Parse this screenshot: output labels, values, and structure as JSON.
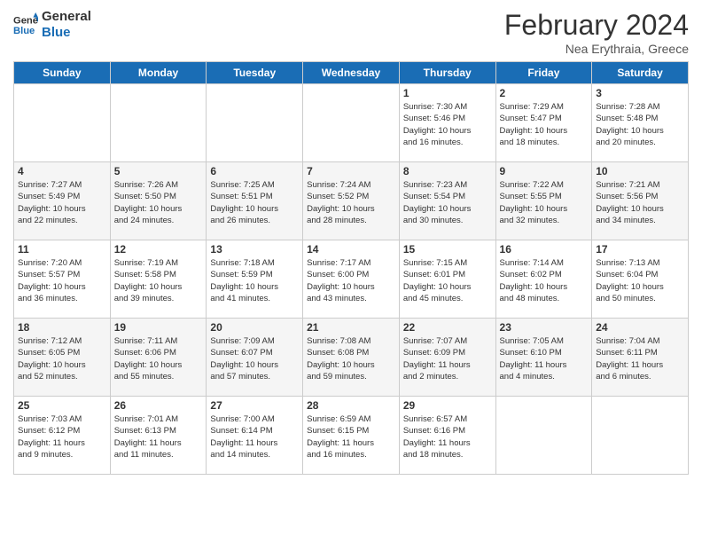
{
  "logo": {
    "line1": "General",
    "line2": "Blue"
  },
  "header": {
    "title": "February 2024",
    "subtitle": "Nea Erythraia, Greece"
  },
  "weekdays": [
    "Sunday",
    "Monday",
    "Tuesday",
    "Wednesday",
    "Thursday",
    "Friday",
    "Saturday"
  ],
  "weeks": [
    [
      {
        "day": "",
        "info": ""
      },
      {
        "day": "",
        "info": ""
      },
      {
        "day": "",
        "info": ""
      },
      {
        "day": "",
        "info": ""
      },
      {
        "day": "1",
        "info": "Sunrise: 7:30 AM\nSunset: 5:46 PM\nDaylight: 10 hours\nand 16 minutes."
      },
      {
        "day": "2",
        "info": "Sunrise: 7:29 AM\nSunset: 5:47 PM\nDaylight: 10 hours\nand 18 minutes."
      },
      {
        "day": "3",
        "info": "Sunrise: 7:28 AM\nSunset: 5:48 PM\nDaylight: 10 hours\nand 20 minutes."
      }
    ],
    [
      {
        "day": "4",
        "info": "Sunrise: 7:27 AM\nSunset: 5:49 PM\nDaylight: 10 hours\nand 22 minutes."
      },
      {
        "day": "5",
        "info": "Sunrise: 7:26 AM\nSunset: 5:50 PM\nDaylight: 10 hours\nand 24 minutes."
      },
      {
        "day": "6",
        "info": "Sunrise: 7:25 AM\nSunset: 5:51 PM\nDaylight: 10 hours\nand 26 minutes."
      },
      {
        "day": "7",
        "info": "Sunrise: 7:24 AM\nSunset: 5:52 PM\nDaylight: 10 hours\nand 28 minutes."
      },
      {
        "day": "8",
        "info": "Sunrise: 7:23 AM\nSunset: 5:54 PM\nDaylight: 10 hours\nand 30 minutes."
      },
      {
        "day": "9",
        "info": "Sunrise: 7:22 AM\nSunset: 5:55 PM\nDaylight: 10 hours\nand 32 minutes."
      },
      {
        "day": "10",
        "info": "Sunrise: 7:21 AM\nSunset: 5:56 PM\nDaylight: 10 hours\nand 34 minutes."
      }
    ],
    [
      {
        "day": "11",
        "info": "Sunrise: 7:20 AM\nSunset: 5:57 PM\nDaylight: 10 hours\nand 36 minutes."
      },
      {
        "day": "12",
        "info": "Sunrise: 7:19 AM\nSunset: 5:58 PM\nDaylight: 10 hours\nand 39 minutes."
      },
      {
        "day": "13",
        "info": "Sunrise: 7:18 AM\nSunset: 5:59 PM\nDaylight: 10 hours\nand 41 minutes."
      },
      {
        "day": "14",
        "info": "Sunrise: 7:17 AM\nSunset: 6:00 PM\nDaylight: 10 hours\nand 43 minutes."
      },
      {
        "day": "15",
        "info": "Sunrise: 7:15 AM\nSunset: 6:01 PM\nDaylight: 10 hours\nand 45 minutes."
      },
      {
        "day": "16",
        "info": "Sunrise: 7:14 AM\nSunset: 6:02 PM\nDaylight: 10 hours\nand 48 minutes."
      },
      {
        "day": "17",
        "info": "Sunrise: 7:13 AM\nSunset: 6:04 PM\nDaylight: 10 hours\nand 50 minutes."
      }
    ],
    [
      {
        "day": "18",
        "info": "Sunrise: 7:12 AM\nSunset: 6:05 PM\nDaylight: 10 hours\nand 52 minutes."
      },
      {
        "day": "19",
        "info": "Sunrise: 7:11 AM\nSunset: 6:06 PM\nDaylight: 10 hours\nand 55 minutes."
      },
      {
        "day": "20",
        "info": "Sunrise: 7:09 AM\nSunset: 6:07 PM\nDaylight: 10 hours\nand 57 minutes."
      },
      {
        "day": "21",
        "info": "Sunrise: 7:08 AM\nSunset: 6:08 PM\nDaylight: 10 hours\nand 59 minutes."
      },
      {
        "day": "22",
        "info": "Sunrise: 7:07 AM\nSunset: 6:09 PM\nDaylight: 11 hours\nand 2 minutes."
      },
      {
        "day": "23",
        "info": "Sunrise: 7:05 AM\nSunset: 6:10 PM\nDaylight: 11 hours\nand 4 minutes."
      },
      {
        "day": "24",
        "info": "Sunrise: 7:04 AM\nSunset: 6:11 PM\nDaylight: 11 hours\nand 6 minutes."
      }
    ],
    [
      {
        "day": "25",
        "info": "Sunrise: 7:03 AM\nSunset: 6:12 PM\nDaylight: 11 hours\nand 9 minutes."
      },
      {
        "day": "26",
        "info": "Sunrise: 7:01 AM\nSunset: 6:13 PM\nDaylight: 11 hours\nand 11 minutes."
      },
      {
        "day": "27",
        "info": "Sunrise: 7:00 AM\nSunset: 6:14 PM\nDaylight: 11 hours\nand 14 minutes."
      },
      {
        "day": "28",
        "info": "Sunrise: 6:59 AM\nSunset: 6:15 PM\nDaylight: 11 hours\nand 16 minutes."
      },
      {
        "day": "29",
        "info": "Sunrise: 6:57 AM\nSunset: 6:16 PM\nDaylight: 11 hours\nand 18 minutes."
      },
      {
        "day": "",
        "info": ""
      },
      {
        "day": "",
        "info": ""
      }
    ]
  ]
}
